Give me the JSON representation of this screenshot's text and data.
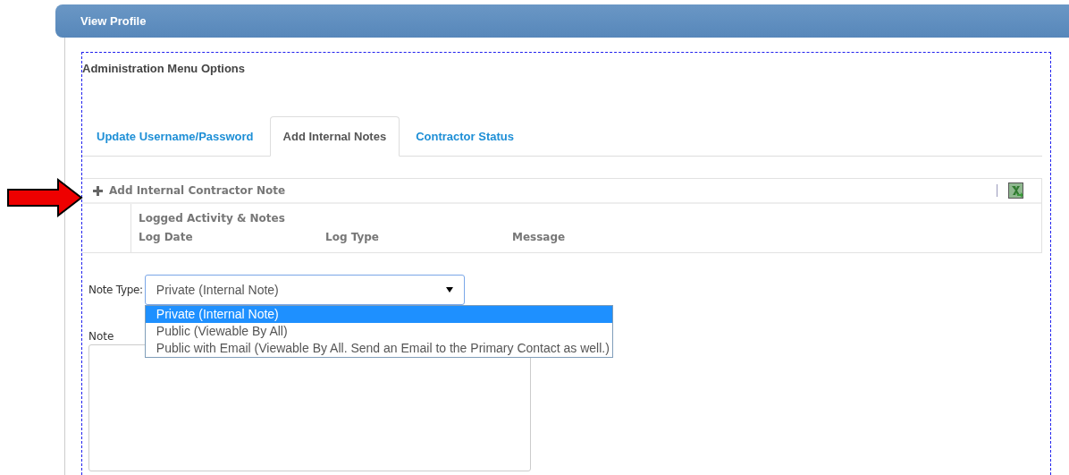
{
  "header": {
    "title": "View Profile"
  },
  "section_title": "Administration Menu Options",
  "tabs": [
    {
      "label": "Update Username/Password",
      "selected": false
    },
    {
      "label": "Add Internal Notes",
      "selected": true
    },
    {
      "label": "Contractor Status",
      "selected": false
    }
  ],
  "grid": {
    "add_button": "Add Internal Contractor Note",
    "group_title": "Logged Activity & Notes",
    "columns": [
      "Log Date",
      "Log Type",
      "Message"
    ]
  },
  "note_type": {
    "label": "Note Type:",
    "value": "Private (Internal Note)",
    "expanded": true,
    "options": [
      {
        "label": "Private (Internal Note)",
        "selected": true
      },
      {
        "label": "Public (Viewable By All)",
        "selected": false
      },
      {
        "label": "Public with Email (Viewable By All. Send an Email to the Primary Contact as well.)",
        "selected": false
      }
    ]
  },
  "note": {
    "label": "Note"
  }
}
